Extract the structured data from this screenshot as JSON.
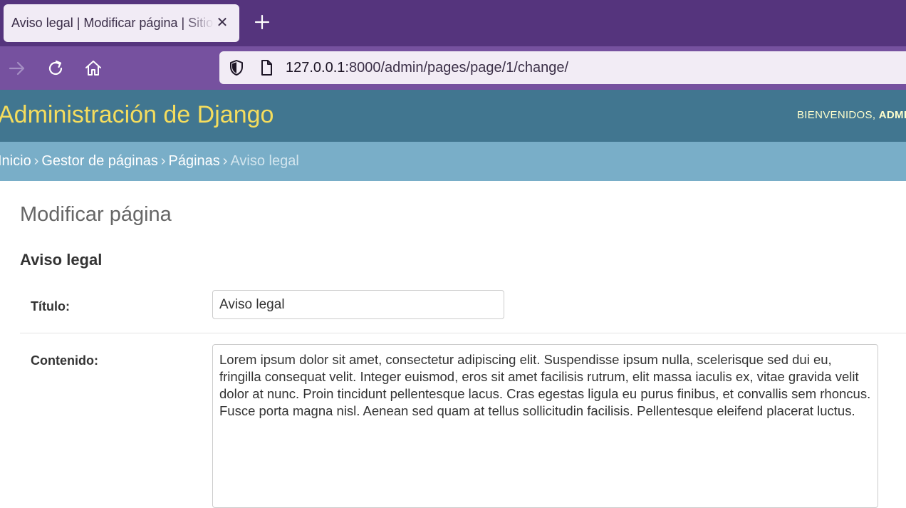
{
  "browser": {
    "tab": {
      "title": "Aviso legal | Modificar página | Sitio de administración de Django"
    },
    "url": {
      "host": "127.0.0.1",
      "rest": ":8000/admin/pages/page/1/change/"
    }
  },
  "header": {
    "site_name": "Administración de Django",
    "welcome": "BIENVENIDOS,",
    "user": "ADMIN"
  },
  "breadcrumbs": {
    "home": "Inicio",
    "app": "Gestor de páginas",
    "model": "Páginas",
    "current": "Aviso legal",
    "separator": "›"
  },
  "main": {
    "page_title": "Modificar página",
    "object_title": "Aviso legal",
    "fields": {
      "title_label": "Título:",
      "title_value": "Aviso legal",
      "content_label": "Contenido:",
      "content_value": "Lorem ipsum dolor sit amet, consectetur adipiscing elit. Suspendisse ipsum nulla, scelerisque sed dui eu, fringilla consequat velit. Integer euismod, eros sit amet facilisis rutrum, elit massa iaculis ex, vitae gravida velit dolor at nunc. Proin tincidunt pellentesque lacus. Cras egestas ligula eu purus finibus, et convallis sem rhoncus. Fusce porta magna nisl. Aenean sed quam at tellus sollicitudin facilisis. Pellentesque eleifend placerat luctus."
    }
  },
  "colors": {
    "tabbar": "#55347d",
    "toolbar": "#76519f",
    "header": "#417690",
    "site_name": "#f5dd5d",
    "breadcrumbs": "#79aec8"
  }
}
